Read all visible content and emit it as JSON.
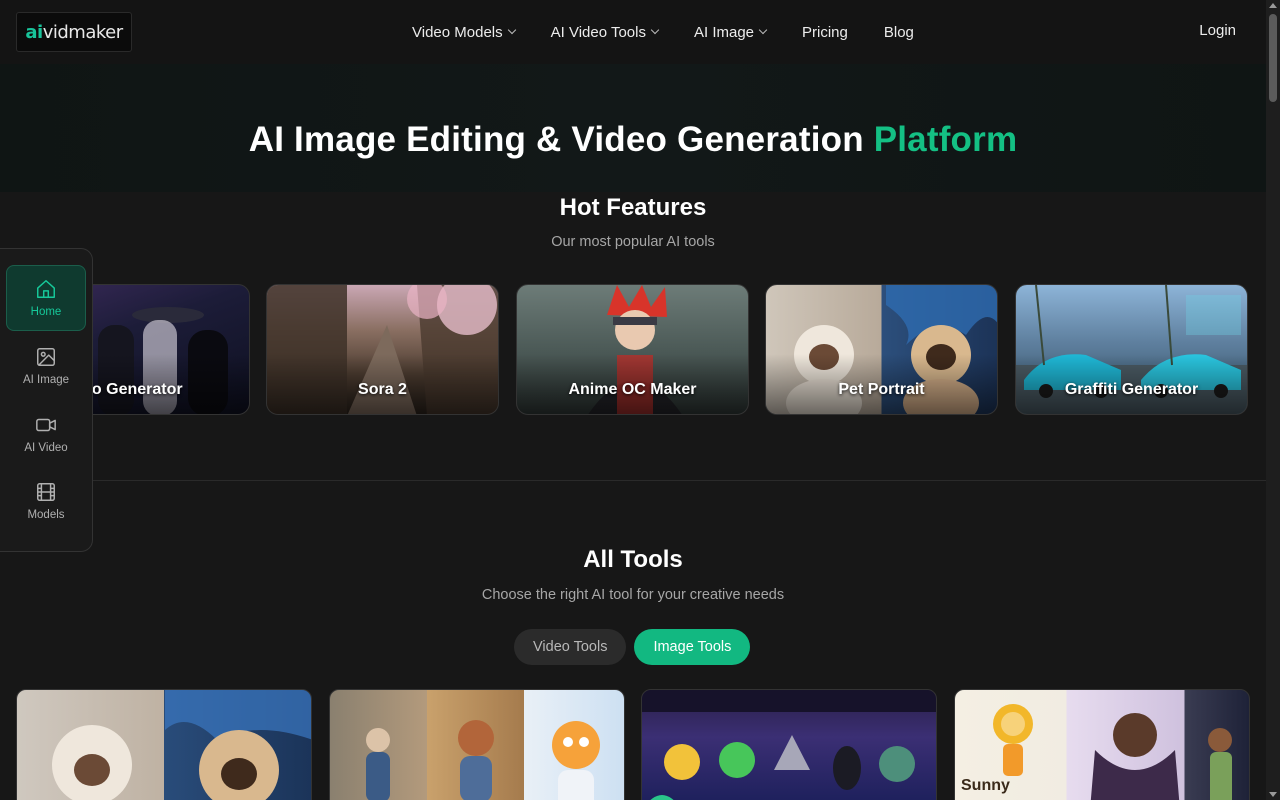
{
  "brand": {
    "logo_ai": "ai",
    "logo_rest": "vidmaker"
  },
  "nav": {
    "items": [
      {
        "label": "Video Models",
        "dropdown": true
      },
      {
        "label": "AI Video Tools",
        "dropdown": true
      },
      {
        "label": "AI Image",
        "dropdown": true
      },
      {
        "label": "Pricing",
        "dropdown": false
      },
      {
        "label": "Blog",
        "dropdown": false
      }
    ],
    "login": "Login"
  },
  "hero": {
    "title_main": "AI Image Editing & Video Generation ",
    "title_accent": "Platform"
  },
  "hot_features": {
    "title": "Hot Features",
    "subtitle": "Our most popular AI tools",
    "cards": [
      {
        "label": "Video Generator"
      },
      {
        "label": "Sora 2"
      },
      {
        "label": "Anime OC Maker"
      },
      {
        "label": "Pet Portrait"
      },
      {
        "label": "Graffiti Generator"
      }
    ]
  },
  "sidebar": {
    "items": [
      {
        "label": "Home",
        "icon": "home-icon",
        "active": true
      },
      {
        "label": "AI Image",
        "icon": "image-icon",
        "active": false
      },
      {
        "label": "AI Video",
        "icon": "video-camera-icon",
        "active": false
      },
      {
        "label": "Models",
        "icon": "film-icon",
        "active": false
      }
    ]
  },
  "all_tools": {
    "title": "All Tools",
    "subtitle": "Choose the right AI tool for your creative needs",
    "tabs": [
      {
        "label": "Video Tools",
        "active": false
      },
      {
        "label": "Image Tools",
        "active": true
      }
    ]
  },
  "colors": {
    "accent": "#14c084",
    "tab_active": "#12b881",
    "background": "#171717"
  }
}
